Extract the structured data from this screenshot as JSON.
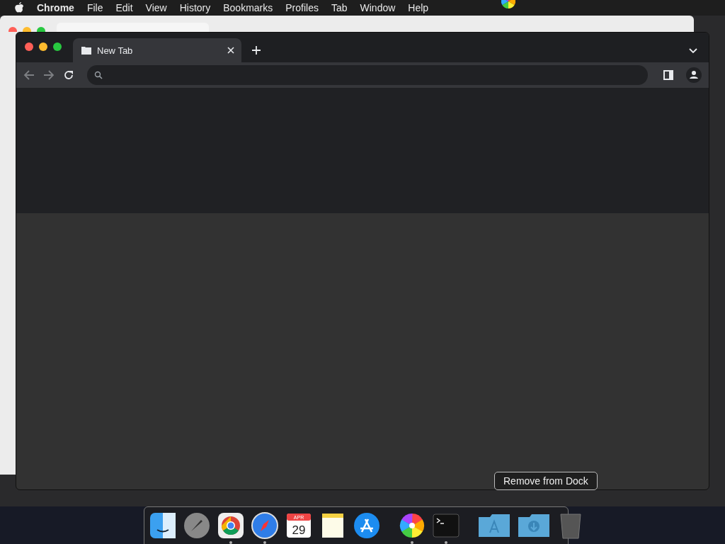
{
  "menu_bar": {
    "app": "Chrome",
    "items": [
      "File",
      "Edit",
      "View",
      "History",
      "Bookmarks",
      "Profiles",
      "Tab",
      "Window",
      "Help"
    ]
  },
  "window": {
    "tabs": [
      {
        "title": "New Tab",
        "selected": true
      }
    ]
  },
  "dock": {
    "items": [
      {
        "kind": "finder",
        "running": false
      },
      {
        "kind": "launchpad",
        "running": false
      },
      {
        "kind": "chrome",
        "running": true
      },
      {
        "kind": "safari",
        "running": true
      },
      {
        "kind": "calendar",
        "running": false,
        "month": "APR",
        "day": "29"
      },
      {
        "kind": "notes",
        "running": false
      },
      {
        "kind": "appstore",
        "running": false
      },
      {
        "kind": "separator"
      },
      {
        "kind": "pinwheel",
        "running": true
      },
      {
        "kind": "terminal",
        "running": true
      },
      {
        "kind": "separator"
      },
      {
        "kind": "apps-folder",
        "running": false
      },
      {
        "kind": "downloads-folder",
        "running": false
      },
      {
        "kind": "trash",
        "running": false
      }
    ],
    "tooltip": "Remove from Dock"
  }
}
